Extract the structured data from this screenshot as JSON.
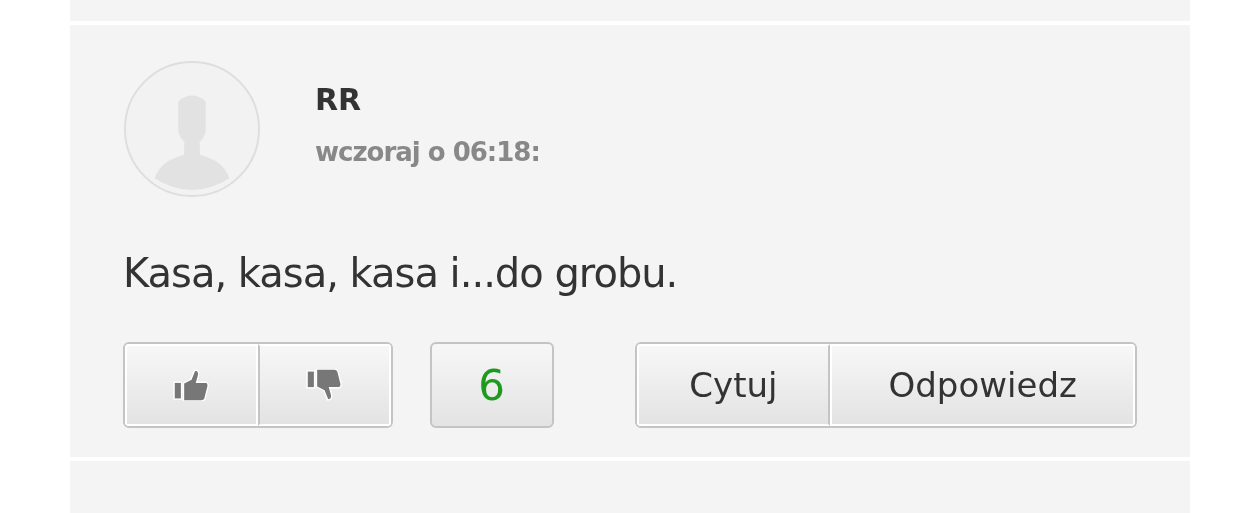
{
  "comment": {
    "author": "RR",
    "time": "wczoraj o 06:18:",
    "text": "Kasa, kasa, kasa i...do grobu.",
    "score": "6",
    "actions": [
      "Cytuj",
      "Odpowiedz"
    ]
  }
}
